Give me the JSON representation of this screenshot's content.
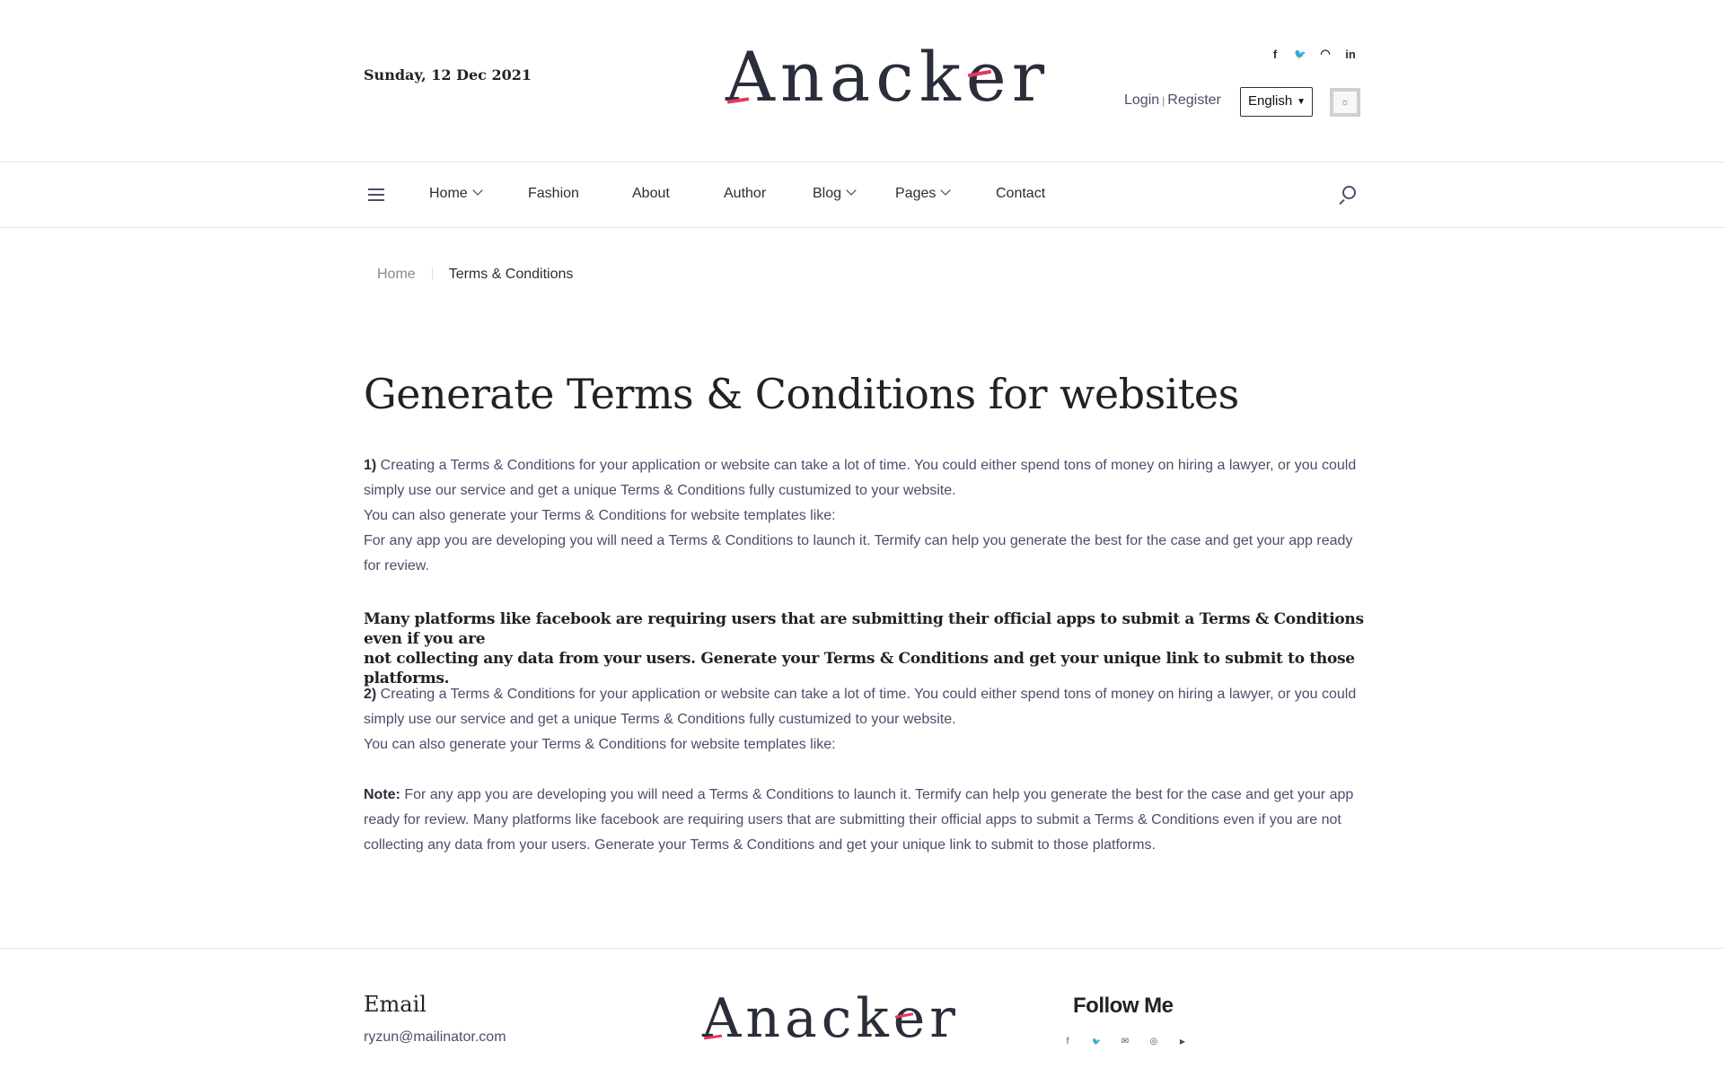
{
  "header": {
    "date": "Sunday, 12 Dec 2021",
    "logo": {
      "a": "A",
      "mid": "nack",
      "e": "e",
      "end": "r"
    },
    "social": [
      {
        "icon": "facebook-icon",
        "glyph": "f"
      },
      {
        "icon": "twitter-icon",
        "glyph": "🐦"
      },
      {
        "icon": "rss-icon",
        "glyph": "◠"
      },
      {
        "icon": "linkedin-icon",
        "glyph": "in"
      }
    ],
    "login": "Login",
    "auth_sep": "|",
    "register": "Register",
    "language": "English",
    "theme_glyph": "☼"
  },
  "nav": {
    "items": [
      {
        "label": "Home",
        "has_caret": true
      },
      {
        "label": "Fashion",
        "has_caret": false
      },
      {
        "label": "About",
        "has_caret": false
      },
      {
        "label": "Author",
        "has_caret": false
      },
      {
        "label": "Blog",
        "has_caret": true
      },
      {
        "label": "Pages",
        "has_caret": true
      },
      {
        "label": "Contact",
        "has_caret": false
      }
    ]
  },
  "breadcrumb": {
    "home": "Home",
    "current": "Terms & Conditions"
  },
  "content": {
    "title": "Generate Terms & Conditions for websites",
    "p1_num": "1)",
    "p1_l1": " Creating a Terms & Conditions for your application or website can take a lot of time. You could either spend tons of money on hiring a lawyer, or you could",
    "p1_l2": "simply use our service and get a unique Terms & Conditions fully custumized to your website.",
    "p1_l3": "You can also generate your Terms & Conditions for website templates like:",
    "p1_l4": "For any app you are developing you will need a Terms & Conditions to launch it. Termify can help you generate the best for the case and get your app ready",
    "p1_l5": "for review.",
    "bold_l1": "Many platforms like facebook are requiring users that are submitting their official apps to submit a Terms & Conditions even if you are",
    "bold_l2": "not collecting any data from your users. Generate your Terms & Conditions and get your unique link to submit to those platforms.",
    "p2_num": "2)",
    "p2_l1": " Creating a Terms & Conditions for your application or website can take a lot of time. You could either spend tons of money on hiring a lawyer, or you could",
    "p2_l2": "simply use our service and get a unique Terms & Conditions fully custumized to your website.",
    "p2_l3": "You can also generate your Terms & Conditions for website templates like:",
    "note_label": "Note:",
    "note_l1": " For any app you are developing you will need a Terms & Conditions to launch it. Termify can help you generate the best for the case and get your app",
    "note_l2": "ready for review. Many platforms like facebook are requiring users that are submitting their official apps to submit a Terms & Conditions even if you are not",
    "note_l3": "collecting any data from your users. Generate your Terms & Conditions and get your unique link to submit to those platforms."
  },
  "footer": {
    "email_title": "Email",
    "email": "ryzun@mailinator.com",
    "follow_title": "Follow Me",
    "social": [
      {
        "icon": "facebook-icon",
        "glyph": "f"
      },
      {
        "icon": "twitter-icon",
        "glyph": "🐦"
      },
      {
        "icon": "mail-icon",
        "glyph": "✉"
      },
      {
        "icon": "instagram-icon",
        "glyph": "◎"
      },
      {
        "icon": "youtube-icon",
        "glyph": "▶"
      }
    ]
  }
}
